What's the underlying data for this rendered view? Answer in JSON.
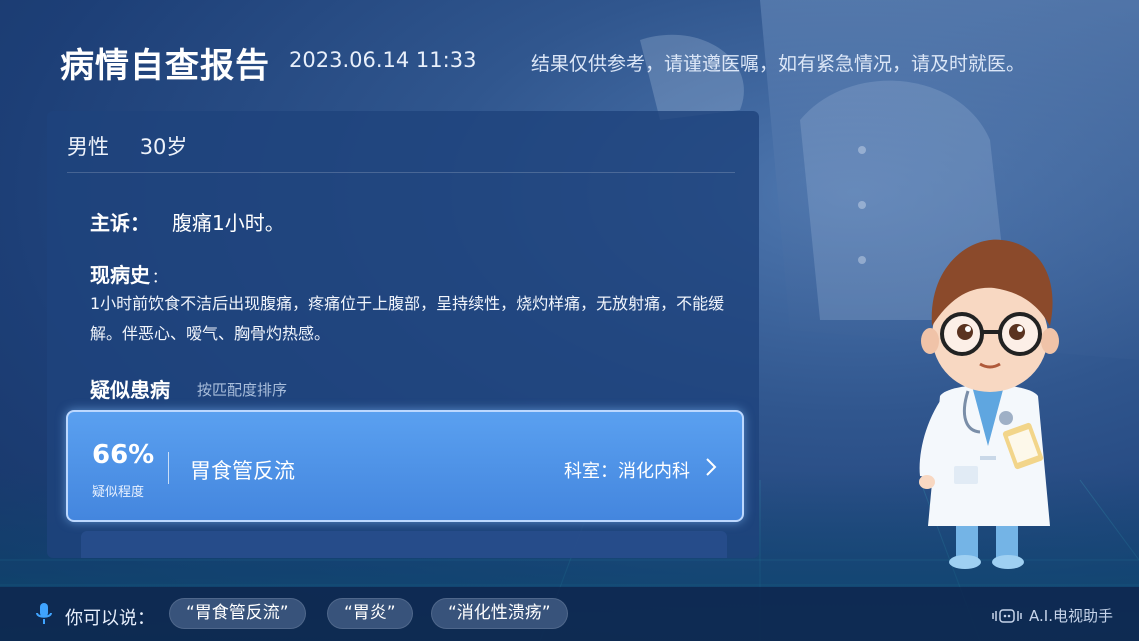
{
  "header": {
    "title": "病情自查报告",
    "time": "2023.06.14 11:33",
    "disclaimer": "结果仅供参考，请谨遵医嘱，如有紧急情况，请及时就医。"
  },
  "patient": {
    "gender": "男性",
    "age": "30岁"
  },
  "complaint": {
    "label": "主诉：",
    "text": "腹痛1小时。"
  },
  "history": {
    "label": "现病史",
    "colon": "：",
    "text": "1小时前饮食不洁后出现腹痛，疼痛位于上腹部，呈持续性，烧灼样痛，无放射痛，不能缓解。伴恶心、嗳气、胸骨灼热感。"
  },
  "suspected": {
    "label": "疑似患病",
    "sort_hint": "按匹配度排序",
    "items": [
      {
        "match": "66%",
        "match_label": "疑似程度",
        "name": "胃食管反流",
        "department": "科室：消化内科"
      }
    ]
  },
  "bottom": {
    "hint": "你可以说：",
    "suggestions": [
      "“胃食管反流”",
      "“胃炎”",
      "“消化性溃疡”"
    ],
    "assistant": "A.I.电视助手"
  },
  "colors": {
    "background": "#1d3f77",
    "panel": "#1f437d",
    "card": "#4a8ce4",
    "card_border": "#bcd8ff"
  },
  "icons": [
    "mic-icon",
    "chevron-right-icon",
    "assistant-logo-icon"
  ]
}
